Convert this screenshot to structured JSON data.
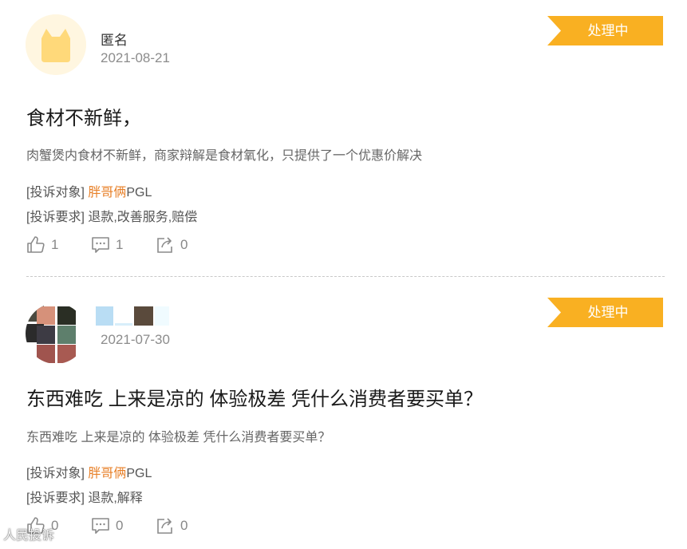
{
  "complaints": [
    {
      "username": "匿名",
      "date": "2021-08-21",
      "status": "处理中",
      "title": "食材不新鲜，",
      "description": "肉蟹煲内食材不新鲜，商家辩解是食材氧化，只提供了一个优惠价解决",
      "target_label": "[投诉对象]",
      "target_name": "胖哥俩",
      "target_suffix": "PGL",
      "request_label": "[投诉要求]",
      "request_value": "退款,改善服务,赔偿",
      "likes": "1",
      "comments": "1",
      "shares": "0"
    },
    {
      "username": "",
      "date": "2021-07-30",
      "status": "处理中",
      "title": "东西难吃 上来是凉的 体验极差 凭什么消费者要买单？",
      "description": "东西难吃 上来是凉的 体验极差 凭什么消费者要买单？",
      "target_label": "[投诉对象]",
      "target_name": "胖哥俩",
      "target_suffix": "PGL",
      "request_label": "[投诉要求]",
      "request_value": "退款,解释",
      "likes": "0",
      "comments": "0",
      "shares": "0"
    }
  ],
  "watermark": "人民投诉",
  "colors": {
    "badge": "#f9b022",
    "link": "#e8812a",
    "avatar_bg": "#fff6e0",
    "avatar_cat": "#ffd97a"
  },
  "icons": [
    "cat-avatar-icon",
    "thumbs-up-icon",
    "comment-icon",
    "share-icon"
  ]
}
